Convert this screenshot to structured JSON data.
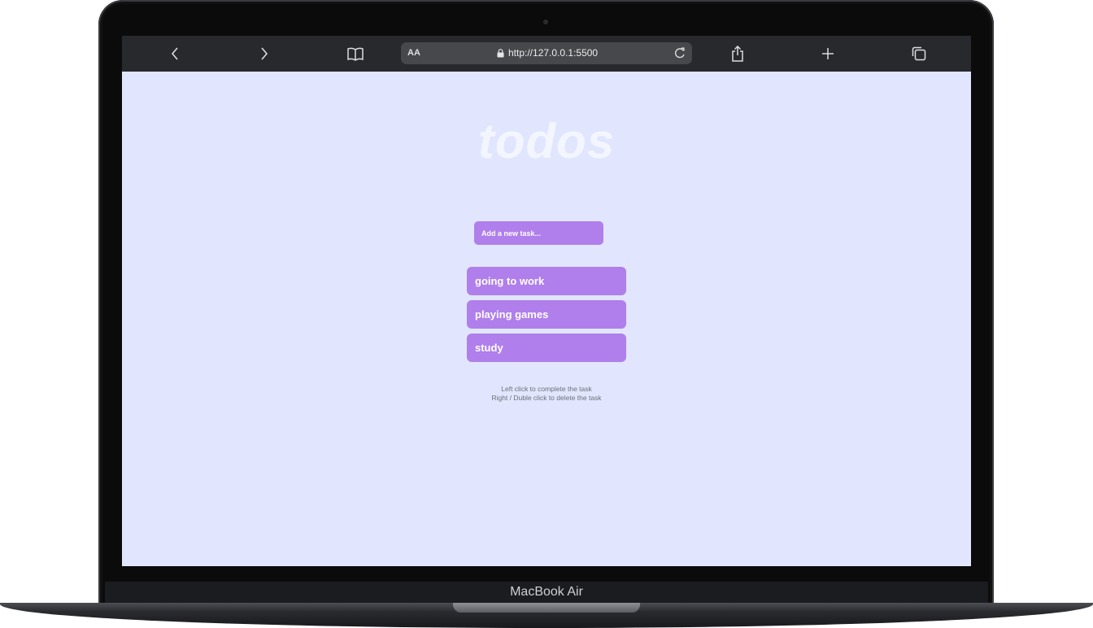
{
  "device": {
    "label": "MacBook Air"
  },
  "browser": {
    "text_size_label": "AA",
    "url": "http://127.0.0.1:5500",
    "icons": [
      "chevron-left-icon",
      "chevron-right-icon",
      "book-icon",
      "lock-icon",
      "reload-icon",
      "share-icon",
      "plus-icon",
      "tabs-icon"
    ]
  },
  "app": {
    "title": "todos",
    "input": {
      "placeholder": "Add a new task...",
      "value": ""
    },
    "tasks": [
      {
        "label": "going to work"
      },
      {
        "label": "playing games"
      },
      {
        "label": "study"
      }
    ],
    "hints": [
      "Left click to complete the task",
      "Right / Duble click to delete the task"
    ],
    "colors": {
      "background": "#e1e6fe",
      "accent": "#b07feb",
      "title": "#f4f6ff"
    }
  }
}
